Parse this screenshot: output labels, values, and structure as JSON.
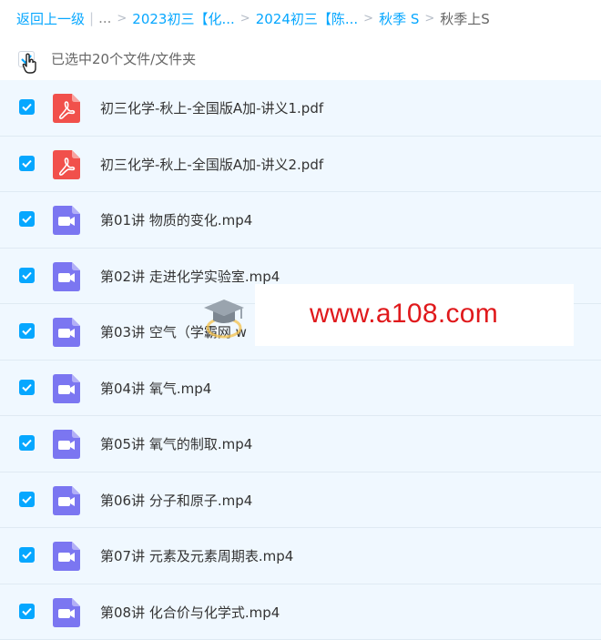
{
  "breadcrumb": {
    "back": "返回上一级",
    "ellipsis": "...",
    "items": [
      "2023初三【化...",
      "2024初三【陈...",
      "秋季 S"
    ],
    "current": "秋季上S"
  },
  "selection": {
    "text": "已选中20个文件/文件夹"
  },
  "colors": {
    "accent": "#06a7ff",
    "row_bg": "#f0f8ff",
    "pdf": "#f1504b",
    "video": "#7b76f1",
    "watermark": "#e0191c"
  },
  "files": [
    {
      "name": "初三化学-秋上-全国版A加-讲义1.pdf",
      "icon": "pdf-icon"
    },
    {
      "name": "初三化学-秋上-全国版A加-讲义2.pdf",
      "icon": "pdf-icon"
    },
    {
      "name": "第01讲 物质的变化.mp4",
      "icon": "video-icon"
    },
    {
      "name": "第02讲 走进化学实验室.mp4",
      "icon": "video-icon"
    },
    {
      "name": "第03讲 空气（学霸网 w",
      "icon": "video-icon"
    },
    {
      "name": "第04讲 氧气.mp4",
      "icon": "video-icon"
    },
    {
      "name": "第05讲 氧气的制取.mp4",
      "icon": "video-icon"
    },
    {
      "name": "第06讲 分子和原子.mp4",
      "icon": "video-icon"
    },
    {
      "name": "第07讲 元素及元素周期表.mp4",
      "icon": "video-icon"
    },
    {
      "name": "第08讲 化合价与化学式.mp4",
      "icon": "video-icon"
    }
  ],
  "watermark": {
    "text": "www.a108.com"
  }
}
